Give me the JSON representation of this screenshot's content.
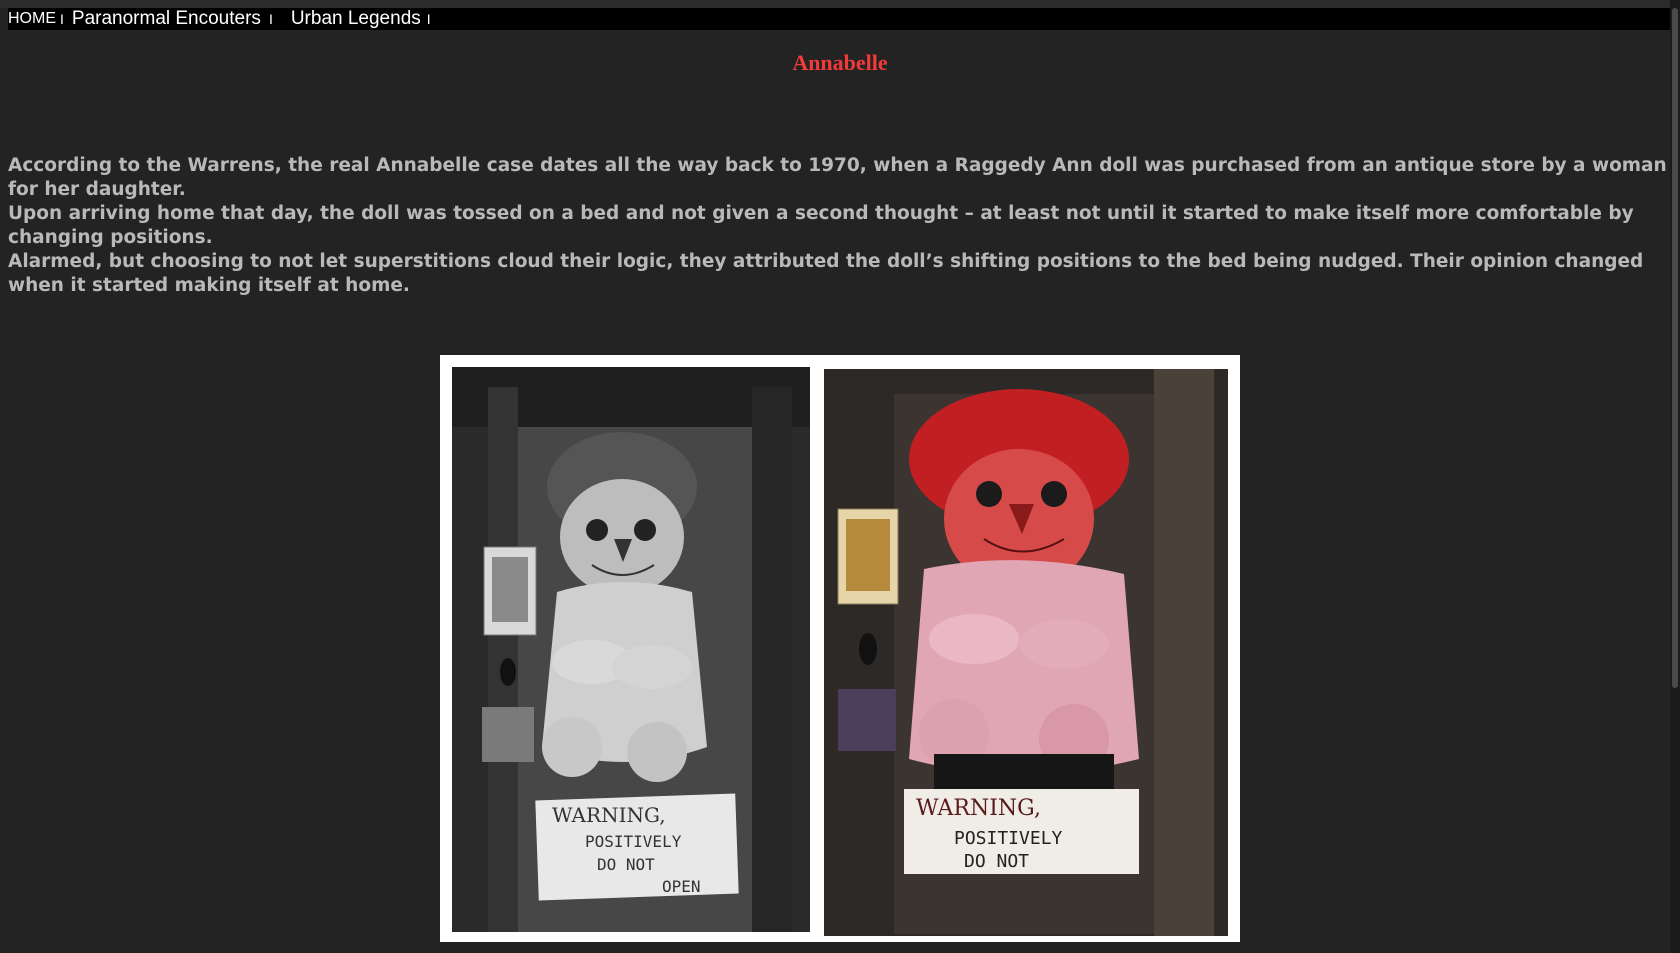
{
  "nav": {
    "home": "HOME",
    "separator": "I",
    "items": [
      "Paranormal Encouters",
      "Urban Legends"
    ]
  },
  "page": {
    "title": "Annabelle",
    "paragraphs": [
      "According to the Warrens, the real Annabelle case dates all the way back to 1970, when a Raggedy Ann doll was purchased from an antique store by a woman for her daughter.",
      "Upon arriving home that day, the doll was tossed on a bed and not given a second thought – at least not until it started to make itself more comfortable by changing positions.",
      "Alarmed, but choosing to not let superstitions cloud their logic, they attributed the doll’s shifting positions to the bed being nudged. Their opinion changed when it started making itself at home."
    ]
  },
  "photos": {
    "left": {
      "sign_line1": "WARNING,",
      "sign_line2": "POSITIVELY",
      "sign_line3": "DO NOT",
      "sign_line4": "OPEN"
    },
    "right": {
      "sign_line1": "WARNING,",
      "sign_line2": "POSITIVELY",
      "sign_line3": "DO NOT"
    }
  },
  "colors": {
    "background": "#232323",
    "navbar": "#000000",
    "title": "#f23a3a",
    "body_text": "#b9b9b9"
  }
}
